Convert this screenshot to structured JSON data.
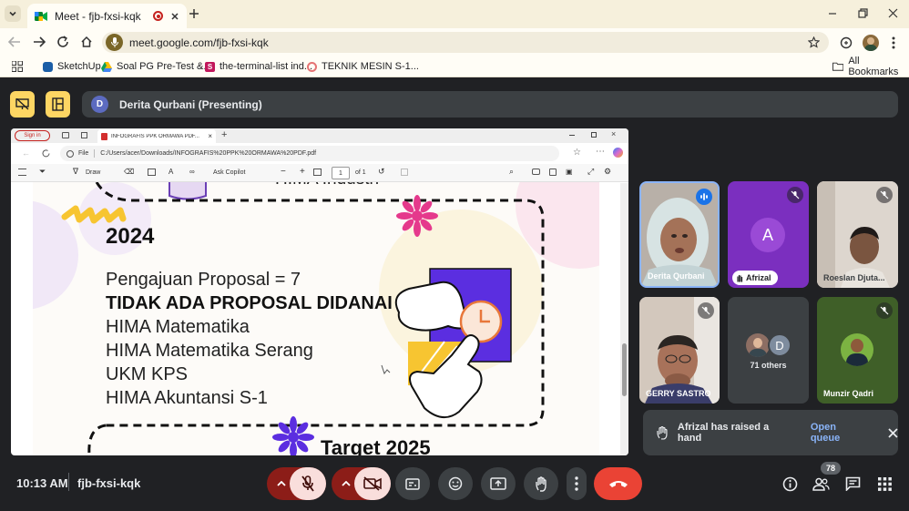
{
  "browser": {
    "tab_title": "Meet - fjb-fxsi-kqk",
    "url": "meet.google.com/fjb-fxsi-kqk",
    "bookmarks": [
      {
        "label": "SketchUp"
      },
      {
        "label": "Soal PG Pre-Test &..."
      },
      {
        "label": "the-terminal-list ind..."
      },
      {
        "label": "TEKNIK MESIN S-1..."
      }
    ],
    "all_bookmarks": "All Bookmarks"
  },
  "meet": {
    "presenter_initial": "D",
    "presenter_label": "Derita Qurbani (Presenting)",
    "time": "10:13 AM",
    "meeting_code": "fjb-fxsi-kqk",
    "people_count": "78",
    "notification": {
      "text": "Afrizal has raised a hand",
      "action": "Open queue"
    },
    "participants": [
      {
        "name": "Derita Qurbani"
      },
      {
        "name": "Afrizal",
        "initial": "A"
      },
      {
        "name": "Roeslan Djuta..."
      },
      {
        "name": "GERRY SASTRO"
      },
      {
        "name": "71 others",
        "initial": "D"
      },
      {
        "name": "Munzir Qadri"
      }
    ]
  },
  "shared": {
    "signin": "Sign in",
    "tab_title": "INFOGRAFIS PPK ORMAWA PDF...",
    "file_label": "File",
    "path": "C:/Users/acer/Downloads/INFOGRAFIS%20PPK%20ORMAWA%20PDF.pdf",
    "draw_label": "Draw",
    "ask_copilot": "Ask Copilot",
    "page_num": "1",
    "page_of": "of 1",
    "slide": {
      "top_text": "HIMA Industri",
      "year": "2024",
      "lines": [
        "Pengajuan Proposal = 7",
        "TIDAK ADA PROPOSAL DIDANAI",
        "HIMA Matematika",
        "HIMA Matematika Serang",
        "UKM KPS",
        "HIMA Akuntansi S-1"
      ],
      "target": "Target 2025"
    }
  },
  "colors": {
    "end_call": "#ea4335",
    "mic_off": "#f9dedc",
    "accent": "#8ab4f8"
  }
}
